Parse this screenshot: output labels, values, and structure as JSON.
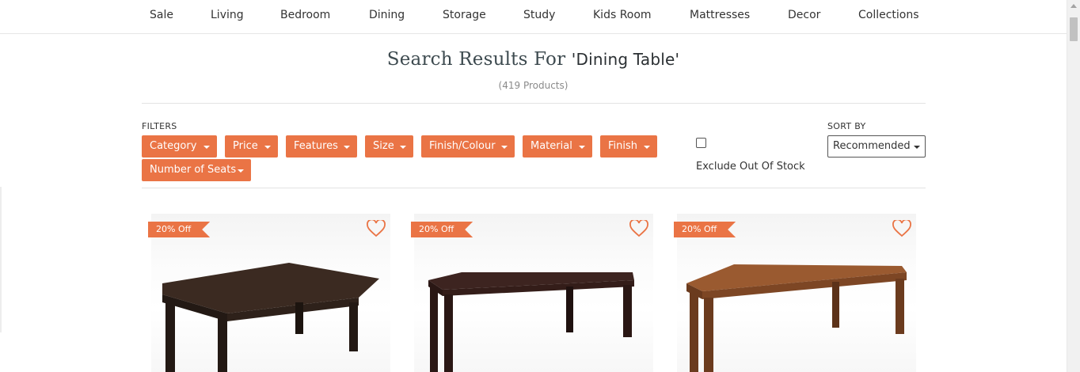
{
  "nav": [
    "Sale",
    "Living",
    "Bedroom",
    "Dining",
    "Storage",
    "Study",
    "Kids Room",
    "Mattresses",
    "Decor",
    "Collections"
  ],
  "search": {
    "prefix": "Search Results For ",
    "query": "'Dining Table'",
    "count": "(419 Products)"
  },
  "filters": {
    "label": "FILTERS",
    "buttons": [
      "Category",
      "Price",
      "Features",
      "Size",
      "Finish/Colour",
      "Material",
      "Finish",
      "Number of Seats"
    ]
  },
  "stock": {
    "label": "Exclude Out Of Stock",
    "checked": false
  },
  "sort": {
    "label": "SORT BY",
    "selected": "Recommended"
  },
  "products": [
    {
      "badge": "20% Off",
      "wood_top": "#3b2a21",
      "wood_side": "#231914"
    },
    {
      "badge": "20% Off",
      "wood_top": "#3d2420",
      "wood_side": "#2a1714"
    },
    {
      "badge": "20% Off",
      "wood_top": "#9a5a30",
      "wood_side": "#6b3b1e"
    }
  ],
  "colors": {
    "accent": "#ea7445",
    "title": "#3d4a4f"
  },
  "icons": [
    "heart-outline-icon",
    "caret-down-icon",
    "checkbox-icon"
  ]
}
